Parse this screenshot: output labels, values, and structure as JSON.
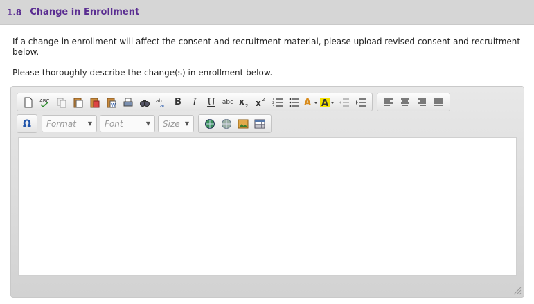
{
  "section": {
    "number": "1.8",
    "title": "Change in Enrollment"
  },
  "instructions": {
    "line1": "If a change in enrollment will affect the consent and recruitment material, please upload revised consent and recruitment below.",
    "line2": "Please thoroughly describe the change(s) in enrollment below."
  },
  "editor": {
    "toolbar": {
      "bold": "B",
      "italic": "I",
      "underline": "U",
      "strike": "abc",
      "special_char": "Ω",
      "format_placeholder": "Format",
      "font_placeholder": "Font",
      "size_placeholder": "Size",
      "text_color_label": "A",
      "bg_color_label": "A"
    },
    "content": ""
  },
  "colors": {
    "accent": "#5a2d91",
    "header_bg": "#d6d6d6"
  }
}
